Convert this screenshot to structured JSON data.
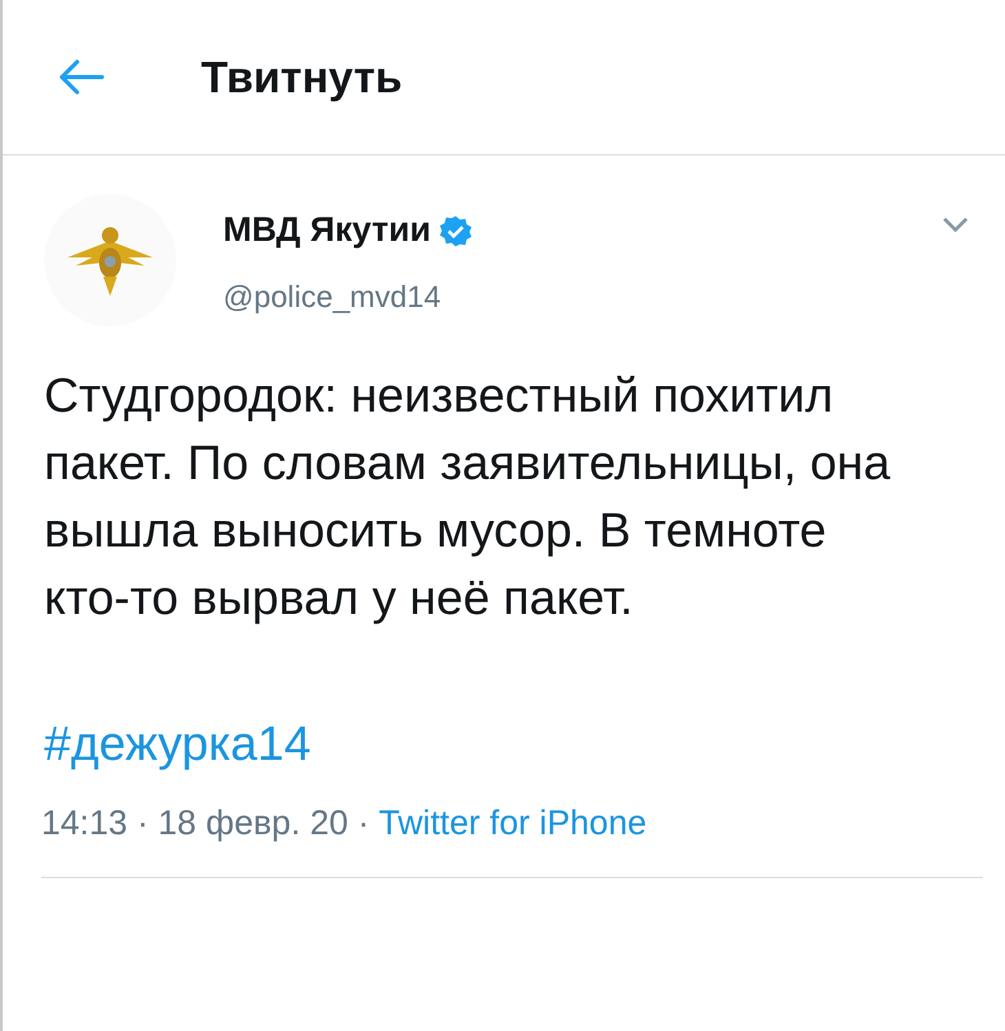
{
  "header": {
    "title": "Твитнуть"
  },
  "tweet": {
    "author": {
      "name": "МВД Якутии",
      "verified": true,
      "handle": "@police_mvd14"
    },
    "text": "Студгородок: неизвестный похитил пакет. По словам заявительницы, она вышла выносить мусор. В темноте кто-то вырвал у неё пакет.",
    "hashtag": "#дежурка14",
    "meta": "14:13 · 18 февр. 20 · ",
    "source": "Twitter for iPhone"
  }
}
